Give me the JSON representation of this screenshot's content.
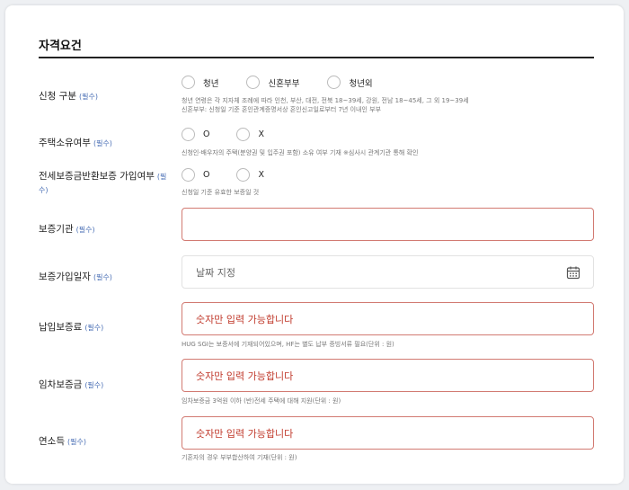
{
  "section": {
    "title": "자격요건"
  },
  "required_tag": "(필수)",
  "fields": {
    "apply_type": {
      "label": "신청 구분",
      "options": [
        "청년",
        "신혼부부",
        "청년외"
      ],
      "help_1": "청년 연령은 각 지자체 조례에 따라 인천, 부산, 대전, 전북 18~39세, 강원, 전남 18~45세, 그 외 19~39세",
      "help_2": "신혼부부: 신청일 기준 혼인관계증명서상 혼인신고일로부터 7년 이내인 부부"
    },
    "house_owner": {
      "label": "주택소유여부",
      "options": [
        "O",
        "X"
      ],
      "help": "신청인·배우자의 주택(분양권 및 입주권 포함) 소유 여부 기재 ※심사시 관계기관 통해 확인"
    },
    "deposit_insurance": {
      "label_1": "전세보증금반환보증 가입여부",
      "label_2": "수)",
      "req_partial": "(필",
      "options": [
        "O",
        "X"
      ],
      "help": "신청일 기준 유효한 보증일 것"
    },
    "guarantee_org": {
      "label": "보증기관",
      "value": ""
    },
    "join_date": {
      "label": "보증가입일자",
      "placeholder": "날짜 지정"
    },
    "premium": {
      "label": "납입보증료",
      "value": "숫자만 입력 가능합니다",
      "help": "HUG SGI는 보증서에 기재되어있으며, HF는 별도 납부 증빙서류 필요(단위 : 원)"
    },
    "rent_deposit": {
      "label": "임차보증금",
      "value": "숫자만 입력 가능합니다",
      "help": "임차보증금 3억원 이하 (반)전세 주택에 대해 지원(단위 : 원)"
    },
    "income": {
      "label": "연소득",
      "value": "숫자만 입력 가능합니다",
      "help": "기혼자의 경우 부부합산하여 기재(단위 : 원)"
    }
  },
  "colors": {
    "error_border": "#d27a72",
    "error_text": "#c0392b",
    "required": "#4a6fb5"
  }
}
